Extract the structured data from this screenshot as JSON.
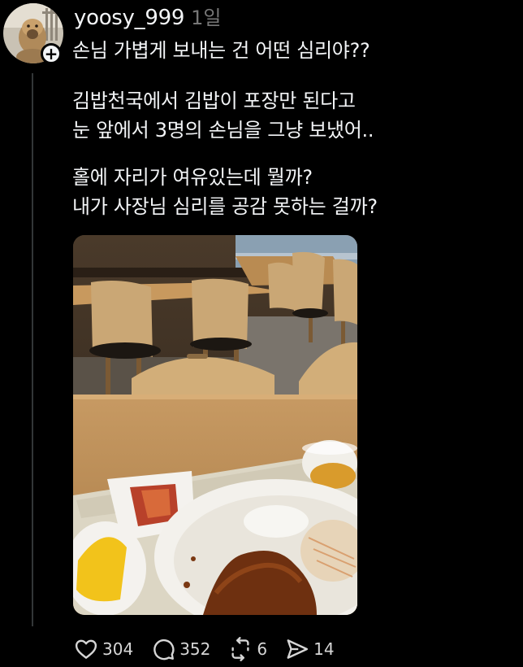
{
  "post": {
    "username": "yoosy_999",
    "time": "1일",
    "title": "손님 가볍게 보내는 건 어떤 심리야??",
    "paragraph1": [
      "김밥천국에서 김밥이 포장만 된다고",
      "눈 앞에서 3명의 손님을 그냥 보냈어.."
    ],
    "paragraph2": [
      "홀에 자리가 여유있는데 뭘까?",
      "내가 사장님 심리를 공감 못하는 걸까?"
    ]
  },
  "actions": {
    "likes": "304",
    "comments": "352",
    "reposts": "6",
    "shares": "14"
  },
  "icons": {
    "like": "heart-icon",
    "comment": "comment-bubble-icon",
    "repost": "repost-icon",
    "share": "send-icon",
    "follow": "plus-icon"
  },
  "colors": {
    "background": "#000000",
    "text": "#f3f5f7",
    "muted": "#777777",
    "thread_line": "#333638"
  }
}
